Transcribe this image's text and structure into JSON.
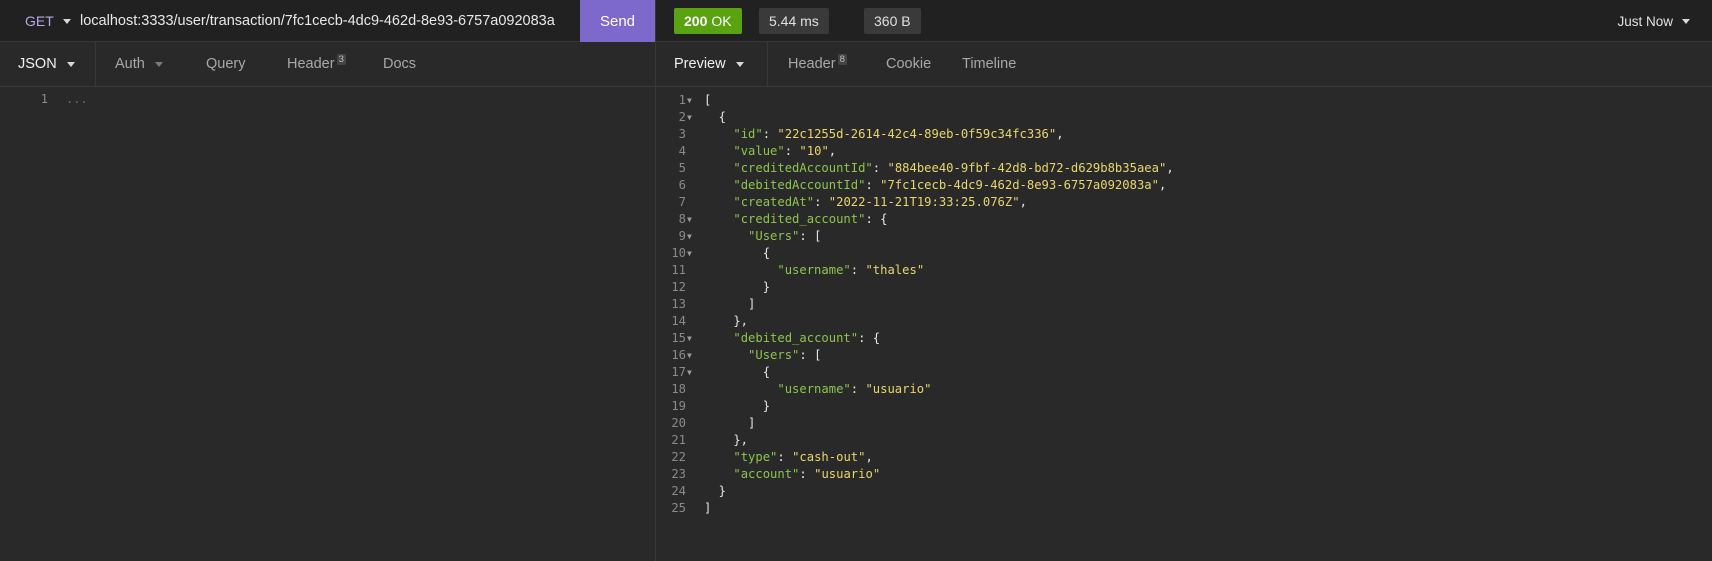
{
  "request": {
    "method": "GET",
    "url": "localhost:3333/user/transaction/7fc1cecb-4dc9-462d-8e93-6757a092083a",
    "send_label": "Send"
  },
  "response_meta": {
    "status_code": "200",
    "status_text": "OK",
    "time": "5.44 ms",
    "size": "360 B",
    "history": "Just Now"
  },
  "colors": {
    "accent": "#7d69cb",
    "success": "#59a210",
    "json_key": "#8dc54d",
    "json_string": "#e9d56e"
  },
  "left_tabs": [
    {
      "label": "JSON",
      "badge": ""
    },
    {
      "label": "Auth",
      "badge": ""
    },
    {
      "label": "Query",
      "badge": ""
    },
    {
      "label": "Header",
      "badge": "3"
    },
    {
      "label": "Docs",
      "badge": ""
    }
  ],
  "right_tabs": [
    {
      "label": "Preview",
      "badge": ""
    },
    {
      "label": "Header",
      "badge": "8"
    },
    {
      "label": "Cookie",
      "badge": ""
    },
    {
      "label": "Timeline",
      "badge": ""
    }
  ],
  "body_editor": {
    "line_number": "1",
    "placeholder": "..."
  },
  "response_body": {
    "id": "22c1255d-2614-42c4-89eb-0f59c34fc336",
    "value": "10",
    "creditedAccountId": "884bee40-9fbf-42d8-bd72-d629b8b35aea",
    "debitedAccountId": "7fc1cecb-4dc9-462d-8e93-6757a092083a",
    "createdAt": "2022-11-21T19:33:25.076Z",
    "credited_username": "thales",
    "debited_username": "usuario",
    "type": "cash-out",
    "account": "usuario"
  },
  "line_numbers": [
    "1",
    "2",
    "3",
    "4",
    "5",
    "6",
    "7",
    "8",
    "9",
    "10",
    "11",
    "12",
    "13",
    "14",
    "15",
    "16",
    "17",
    "18",
    "19",
    "20",
    "21",
    "22",
    "23",
    "24",
    "25"
  ]
}
